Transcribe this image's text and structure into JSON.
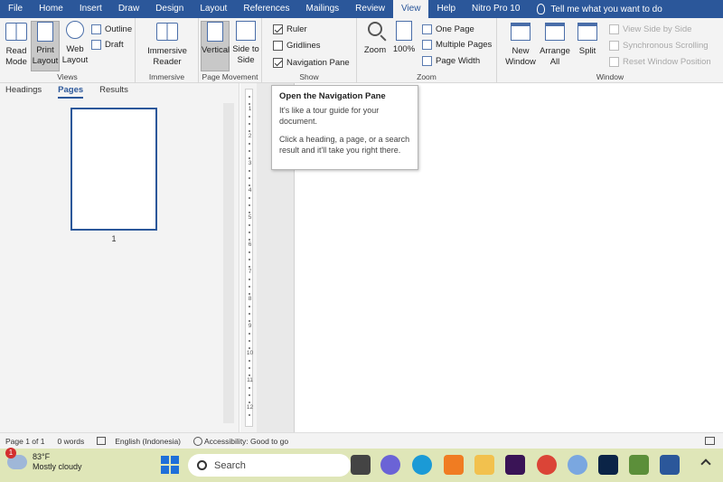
{
  "tabs": [
    "File",
    "Home",
    "Insert",
    "Draw",
    "Design",
    "Layout",
    "References",
    "Mailings",
    "Review",
    "View",
    "Help",
    "Nitro Pro 10"
  ],
  "active_tab": "View",
  "tell_me": "Tell me what you want to do",
  "ribbon": {
    "views": {
      "label": "Views",
      "read_mode": "Read Mode",
      "print_layout": "Print Layout",
      "web_layout": "Web Layout",
      "outline": "Outline",
      "draft": "Draft"
    },
    "immersive": {
      "label": "Immersive",
      "immersive_reader": "Immersive Reader"
    },
    "page_movement": {
      "label": "Page Movement",
      "vertical": "Vertical",
      "side_to_side": "Side to Side"
    },
    "show": {
      "label": "Show",
      "ruler": "Ruler",
      "gridlines": "Gridlines",
      "navigation_pane": "Navigation Pane"
    },
    "zoom": {
      "label": "Zoom",
      "zoom": "Zoom",
      "hundred": "100%",
      "one_page": "One Page",
      "multiple_pages": "Multiple Pages",
      "page_width": "Page Width"
    },
    "window": {
      "label": "Window",
      "new_window": "New Window",
      "arrange_all": "Arrange All",
      "split": "Split",
      "view_side_by_side": "View Side by Side",
      "synchronous_scrolling": "Synchronous Scrolling",
      "reset_window_position": "Reset Window Position"
    }
  },
  "nav": {
    "tabs": [
      "Headings",
      "Pages",
      "Results"
    ],
    "active": "Pages",
    "page_number": "1"
  },
  "ruler_numbers": [
    "1",
    "2",
    "3",
    "4",
    "5",
    "6",
    "7",
    "8",
    "9",
    "10",
    "11",
    "12"
  ],
  "tooltip": {
    "title": "Open the Navigation Pane",
    "p1": "It's like a tour guide for your document.",
    "p2": "Click a heading, a page, or a search result and it'll take you right there."
  },
  "status": {
    "page": "Page 1 of 1",
    "words": "0 words",
    "language": "English (Indonesia)",
    "accessibility": "Accessibility: Good to go"
  },
  "taskbar": {
    "temperature": "83°F",
    "weather": "Mostly cloudy",
    "badge": "1",
    "search": "Search"
  }
}
